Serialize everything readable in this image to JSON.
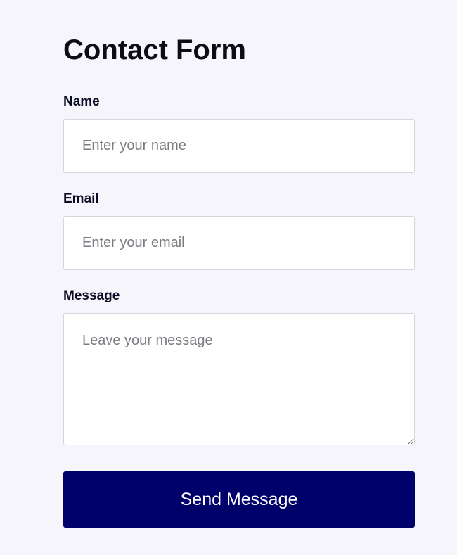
{
  "form": {
    "title": "Contact Form",
    "fields": [
      {
        "label": "Name",
        "value": "",
        "placeholder": "Enter your name"
      },
      {
        "label": "Email",
        "value": "",
        "placeholder": "Enter your email"
      },
      {
        "label": "Message",
        "value": "",
        "placeholder": "Leave your message"
      }
    ],
    "submit_label": "Send Message"
  },
  "colors": {
    "background": "#f6f5fb",
    "button": "#00006b",
    "button_text": "#ffffff",
    "field_border": "#d6d6dc"
  }
}
